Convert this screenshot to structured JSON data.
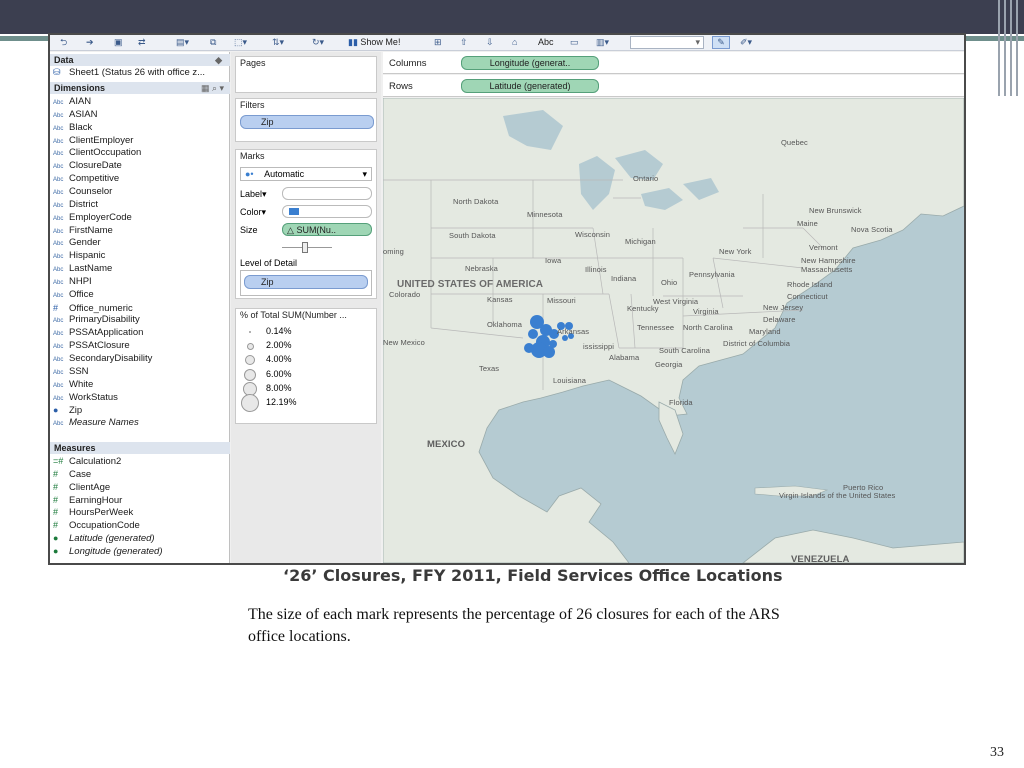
{
  "toolbar": {
    "show_me": "Show Me!",
    "abc": "Abc"
  },
  "data_pane": {
    "header": "Data",
    "source": "Sheet1 (Status 26 with office z...",
    "dimensions_header": "Dimensions",
    "dimensions": [
      {
        "type": "Abc",
        "label": "AIAN"
      },
      {
        "type": "Abc",
        "label": "ASIAN"
      },
      {
        "type": "Abc",
        "label": "Black"
      },
      {
        "type": "Abc",
        "label": "ClientEmployer"
      },
      {
        "type": "Abc",
        "label": "ClientOccupation"
      },
      {
        "type": "Abc",
        "label": "ClosureDate"
      },
      {
        "type": "Abc",
        "label": "Competitive"
      },
      {
        "type": "Abc",
        "label": "Counselor"
      },
      {
        "type": "Abc",
        "label": "District"
      },
      {
        "type": "Abc",
        "label": "EmployerCode"
      },
      {
        "type": "Abc",
        "label": "FirstName"
      },
      {
        "type": "Abc",
        "label": "Gender"
      },
      {
        "type": "Abc",
        "label": "Hispanic"
      },
      {
        "type": "Abc",
        "label": "LastName"
      },
      {
        "type": "Abc",
        "label": "NHPI"
      },
      {
        "type": "Abc",
        "label": "Office"
      },
      {
        "type": "#",
        "label": "Office_numeric"
      },
      {
        "type": "Abc",
        "label": "PrimaryDisability"
      },
      {
        "type": "Abc",
        "label": "PSSAtApplication"
      },
      {
        "type": "Abc",
        "label": "PSSAtClosure"
      },
      {
        "type": "Abc",
        "label": "SecondaryDisability"
      },
      {
        "type": "Abc",
        "label": "SSN"
      },
      {
        "type": "Abc",
        "label": "White"
      },
      {
        "type": "Abc",
        "label": "WorkStatus"
      },
      {
        "type": "globe",
        "label": "Zip"
      },
      {
        "type": "Abc",
        "label": "Measure Names",
        "italic": true
      }
    ],
    "measures_header": "Measures",
    "measures": [
      {
        "type": "=#",
        "label": "Calculation2"
      },
      {
        "type": "#",
        "label": "Case"
      },
      {
        "type": "#",
        "label": "ClientAge"
      },
      {
        "type": "#",
        "label": "EarningHour"
      },
      {
        "type": "#",
        "label": "HoursPerWeek"
      },
      {
        "type": "#",
        "label": "OccupationCode"
      },
      {
        "type": "globe",
        "label": "Latitude (generated)",
        "italic": true
      },
      {
        "type": "globe",
        "label": "Longitude (generated)",
        "italic": true
      }
    ]
  },
  "shelves": {
    "pages": "Pages",
    "filters": "Filters",
    "filter_pill": "Zip",
    "marks": "Marks",
    "mark_type": "Automatic",
    "label": "Label",
    "color": "Color",
    "size": "Size",
    "size_pill": "SUM(Nu..",
    "level_of_detail": "Level of Detail",
    "detail_pill": "Zip",
    "columns": "Columns",
    "columns_pill": "Longitude (generat..",
    "rows": "Rows",
    "rows_pill": "Latitude (generated)"
  },
  "size_legend": {
    "title": "% of Total SUM(Number ...",
    "entries": [
      "0.14%",
      "2.00%",
      "4.00%",
      "6.00%",
      "8.00%",
      "12.19%"
    ]
  },
  "map_labels": {
    "usa": "UNITED STATES OF AMERICA",
    "mexico": "MEXICO",
    "venezuela": "VENEZUELA",
    "states": [
      "Quebec",
      "Ontario",
      "North Dakota",
      "Minnesota",
      "South Dakota",
      "Wisconsin",
      "Michigan",
      "New Brunswick",
      "Maine",
      "Nova Scotia",
      "Vermont",
      "New Hampshire",
      "Massachusetts",
      "New York",
      "Iowa",
      "Nebraska",
      "Illinois",
      "Pennsylvania",
      "Indiana",
      "Ohio",
      "Rhode Island",
      "Connecticut",
      "Colorado",
      "Kansas",
      "Missouri",
      "West Virginia",
      "Kentucky",
      "Virginia",
      "New Jersey",
      "Delaware",
      "Maryland",
      "Oklahoma",
      "Tennessee",
      "North Carolina",
      "Arkansas",
      "ississippi",
      "Alabama",
      "South Carolina",
      "District of Columbia",
      "New Mexico",
      "Texas",
      "Georgia",
      "Louisiana",
      "Florida",
      "Puerto Rico",
      "Virgin Islands of the United States",
      "oming"
    ]
  },
  "caption": "‘26’ Closures, FFY 2011, Field Services Office Locations",
  "description": "The size of each mark represents the percentage of 26 closures for each of the ARS office locations.",
  "page_number": "33",
  "colors": {
    "mark": "#3a7fd0",
    "land": "#e4e9e1",
    "water": "#b5cbd2"
  }
}
